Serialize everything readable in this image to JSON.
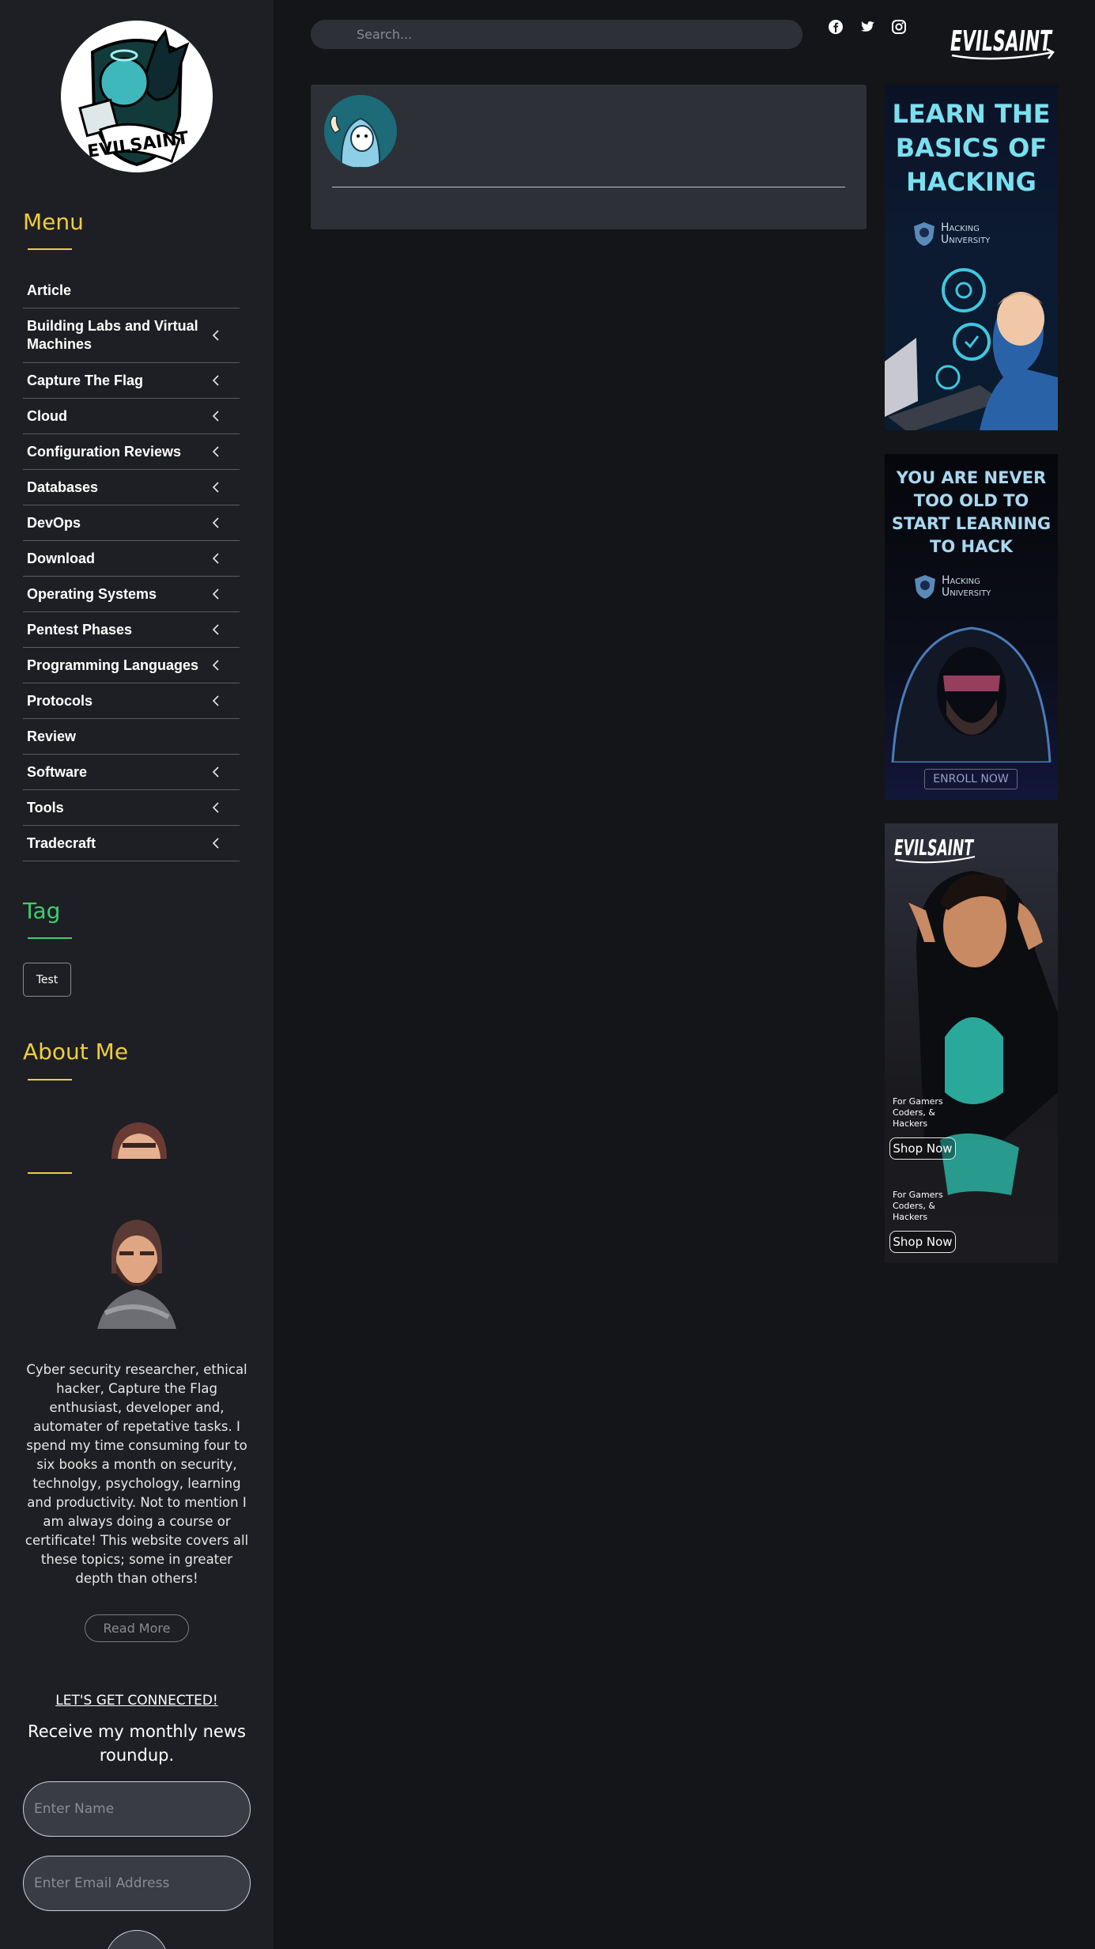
{
  "brand": {
    "logo_text": "EVILSAINT"
  },
  "header": {
    "search_placeholder": "Search...",
    "social": [
      "facebook-icon",
      "twitter-icon",
      "instagram-icon"
    ]
  },
  "sidebar": {
    "menu_title": "Menu",
    "menu_items": [
      {
        "label": "Article",
        "has_submenu": false
      },
      {
        "label": "Building Labs and Virtual Machines",
        "has_submenu": true
      },
      {
        "label": "Capture The Flag",
        "has_submenu": true
      },
      {
        "label": "Cloud",
        "has_submenu": true
      },
      {
        "label": "Configuration Reviews",
        "has_submenu": true
      },
      {
        "label": "Databases",
        "has_submenu": true
      },
      {
        "label": "DevOps",
        "has_submenu": true
      },
      {
        "label": "Download",
        "has_submenu": true
      },
      {
        "label": "Operating Systems",
        "has_submenu": true
      },
      {
        "label": "Pentest Phases",
        "has_submenu": true
      },
      {
        "label": "Programming Languages",
        "has_submenu": true
      },
      {
        "label": "Protocols",
        "has_submenu": true
      },
      {
        "label": "Review",
        "has_submenu": false
      },
      {
        "label": "Software",
        "has_submenu": true
      },
      {
        "label": "Tools",
        "has_submenu": true
      },
      {
        "label": "Tradecraft",
        "has_submenu": true
      }
    ],
    "tag_title": "Tag",
    "tags": [
      "Test"
    ],
    "about_title": "About Me",
    "about_text": "Cyber security researcher, ethical hacker, Capture the Flag enthusiast, developer and, automater of repetative tasks. I spend my time consuming four to six books a month on security, technolgy, psychology, learning and productivity. Not to mention I am always doing a course or certificate! This website covers all these topics; some in greater depth than others!",
    "read_more": "Read More",
    "connect_heading": "LET'S GET CONNECTED!",
    "roundup": "Receive my monthly news roundup.",
    "name_placeholder": "Enter Name",
    "email_placeholder": "Enter Email Address"
  },
  "ads": {
    "ad1": {
      "headline": [
        "LEARN THE",
        "BASICS OF",
        "HACKING"
      ],
      "brand": [
        "Hacking",
        "University"
      ]
    },
    "ad2": {
      "headline": [
        "YOU ARE NEVER",
        "TOO OLD TO",
        "START LEARNING",
        "TO HACK"
      ],
      "brand": [
        "Hacking",
        "University"
      ],
      "cta": "ENROLL NOW"
    },
    "ad3": {
      "logo": "EVILSAINT",
      "tagline": "For Gamers Coders, & Hackers",
      "cta": "Shop Now"
    }
  },
  "colors": {
    "menu_title": "#f0cd3c",
    "tag_title": "#3ccf6e",
    "about_title": "#f0cd3c",
    "ad_cyan": "#7ae0f0"
  }
}
